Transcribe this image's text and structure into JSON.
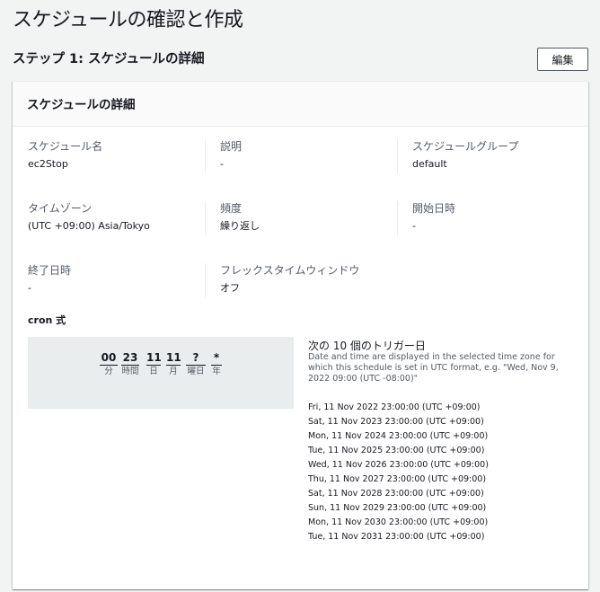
{
  "page": {
    "title": "スケジュールの確認と作成",
    "step_title": "ステップ 1: スケジュールの詳細",
    "edit_label": "編集"
  },
  "card": {
    "title": "スケジュールの詳細",
    "fields": {
      "schedule_name": {
        "label": "スケジュール名",
        "value": "ec2Stop"
      },
      "description": {
        "label": "説明",
        "value": "-"
      },
      "schedule_group": {
        "label": "スケジュールグループ",
        "value": "default"
      },
      "timezone": {
        "label": "タイムゾーン",
        "value": "(UTC +09:00) Asia/Tokyo"
      },
      "frequency": {
        "label": "頻度",
        "value": "繰り返し"
      },
      "start_date": {
        "label": "開始日時",
        "value": "-"
      },
      "end_date": {
        "label": "終了日時",
        "value": "-"
      },
      "flex_window": {
        "label": "フレックスタイムウィンドウ",
        "value": "オフ"
      }
    },
    "cron": {
      "label": "cron 式",
      "parts": [
        {
          "value": "00",
          "unit": "分"
        },
        {
          "value": "23",
          "unit": "時間"
        },
        {
          "value": "11",
          "unit": "日"
        },
        {
          "value": "11",
          "unit": "月"
        },
        {
          "value": "?",
          "unit": "曜日"
        },
        {
          "value": "*",
          "unit": "年"
        }
      ]
    },
    "triggers": {
      "title": "次の 10 個のトリガー日",
      "description": "Date and time are displayed in the selected time zone for which this schedule is set in UTC format, e.g. \"Wed, Nov 9, 2022 09:00 (UTC -08:00)\"",
      "dates": [
        "Fri, 11 Nov 2022 23:00:00 (UTC +09:00)",
        "Sat, 11 Nov 2023 23:00:00 (UTC +09:00)",
        "Mon, 11 Nov 2024 23:00:00 (UTC +09:00)",
        "Tue, 11 Nov 2025 23:00:00 (UTC +09:00)",
        "Wed, 11 Nov 2026 23:00:00 (UTC +09:00)",
        "Thu, 11 Nov 2027 23:00:00 (UTC +09:00)",
        "Sat, 11 Nov 2028 23:00:00 (UTC +09:00)",
        "Sun, 11 Nov 2029 23:00:00 (UTC +09:00)",
        "Mon, 11 Nov 2030 23:00:00 (UTC +09:00)",
        "Tue, 11 Nov 2031 23:00:00 (UTC +09:00)"
      ]
    }
  }
}
